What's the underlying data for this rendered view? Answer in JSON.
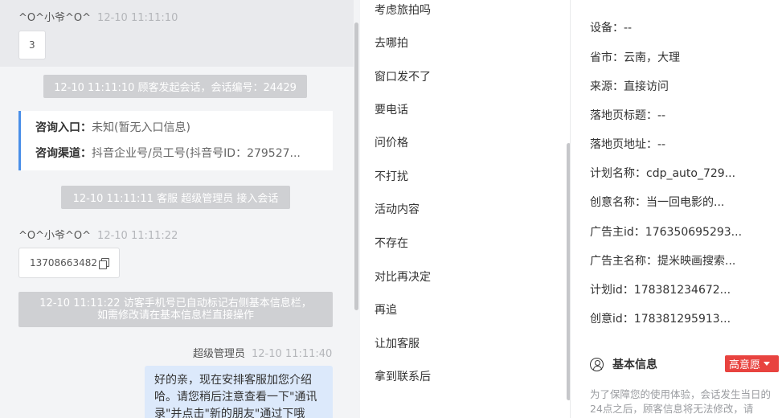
{
  "chat": {
    "visitor_name_1": "^O^小爷^O^",
    "visitor_time_1": "12-10 11:11:10",
    "bubble_1": "3",
    "system_1": "12-10 11:11:10 顾客发起会话，会话编号：24429",
    "card": {
      "entry_label": "咨询入口：",
      "entry_value": "未知(暂无入口信息)",
      "channel_label": "咨询渠道：",
      "channel_value": "抖音企业号/员工号(抖音号ID：279527..."
    },
    "system_2": "12-10 11:11:11 客服 超级管理员 接入会话",
    "visitor_name_2": "^O^小爷^O^",
    "visitor_time_2": "12-10 11:11:22",
    "phone": "13708663482",
    "system_3_line1": "12-10 11:11:22 访客手机号已自动标记右侧基本信息栏，",
    "system_3_line2": "如需修改请在基本信息栏直接操作",
    "agent_name": "超级管理员",
    "agent_time": "12-10 11:11:40",
    "agent_message": "好的亲，现在安排客服加您介绍哈。请您稍后注意查看一下\"通讯录\"并点击\"新的朋友\"通过下哦"
  },
  "replies": [
    "考虑旅拍吗",
    "去哪拍",
    "窗口发不了",
    "要电话",
    "问价格",
    "不打扰",
    "活动内容",
    "不存在",
    "对比再决定",
    "再追",
    "让加客服",
    "拿到联系后"
  ],
  "info": {
    "rows": [
      {
        "label": "设备：",
        "value": "--"
      },
      {
        "label": "省市：",
        "value": "云南，大理"
      },
      {
        "label": "来源：",
        "value": "直接访问"
      },
      {
        "label": "落地页标题：",
        "value": "--"
      },
      {
        "label": "落地页地址：",
        "value": "--"
      },
      {
        "label": "计划名称：",
        "value": "cdp_auto_729..."
      },
      {
        "label": "创意名称：",
        "value": "当一回电影的..."
      },
      {
        "label": "广告主id：",
        "value": "176350695293..."
      },
      {
        "label": "广告主名称：",
        "value": "提米映画搜索..."
      },
      {
        "label": "计划id：",
        "value": "178381234672..."
      },
      {
        "label": "创意id：",
        "value": "178381295913..."
      }
    ],
    "section_title": "基本信息",
    "intent_label": "高意愿",
    "note": "为了保障您的使用体验，会话发生当日的24点之后，顾客信息将无法修改，请"
  },
  "colors": {
    "accent": "#4a8fe8",
    "intent": "#e8433f",
    "agent_bubble": "#dce9fb"
  }
}
